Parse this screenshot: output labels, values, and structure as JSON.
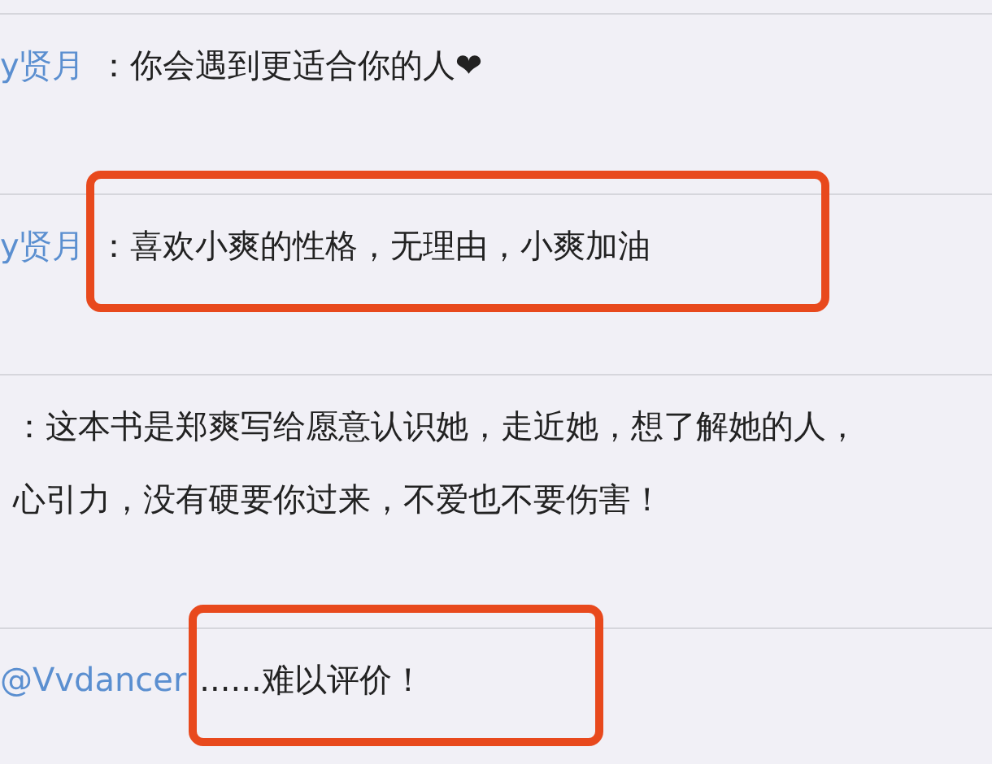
{
  "comments": [
    {
      "author": "y贤月",
      "lines": [
        "：你会遇到更适合你的人❤"
      ],
      "highlighted": false
    },
    {
      "author": "y贤月",
      "lines": [
        "：喜欢小爽的性格，无理由，小爽加油"
      ],
      "highlighted": true
    },
    {
      "lines": [
        "：这本书是郑爽写给愿意认识她，走近她，想了解她的人，",
        "心引力，没有硬要你过来，不爱也不要伤害！"
      ],
      "highlighted": false
    },
    {
      "author": "@Vvdancer",
      "lines": [
        "......难以评价！"
      ],
      "highlighted": true
    }
  ]
}
